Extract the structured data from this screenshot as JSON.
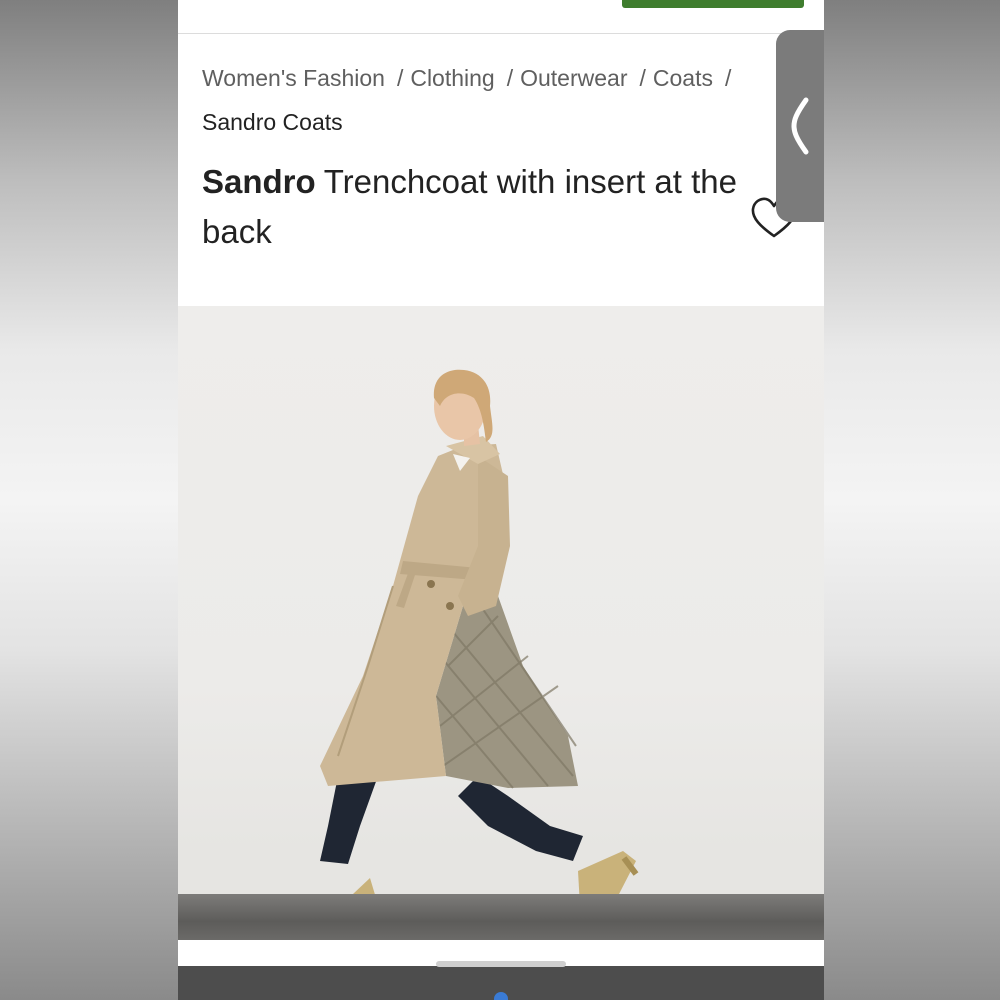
{
  "breadcrumb": {
    "items": [
      "Women's Fashion",
      "Clothing",
      "Outerwear",
      "Coats"
    ],
    "separator": "/",
    "current": "Sandro Coats"
  },
  "product": {
    "brand": "Sandro",
    "name": "Trenchcoat with insert at the back"
  },
  "icons": {
    "favorite": "heart-outline-icon",
    "side_panel": "chevron-left-icon"
  },
  "colors": {
    "accent_green": "#3f7d2e",
    "side_tab": "#7b7b7b",
    "text_primary": "#222222",
    "text_secondary": "#5f5f5f"
  }
}
